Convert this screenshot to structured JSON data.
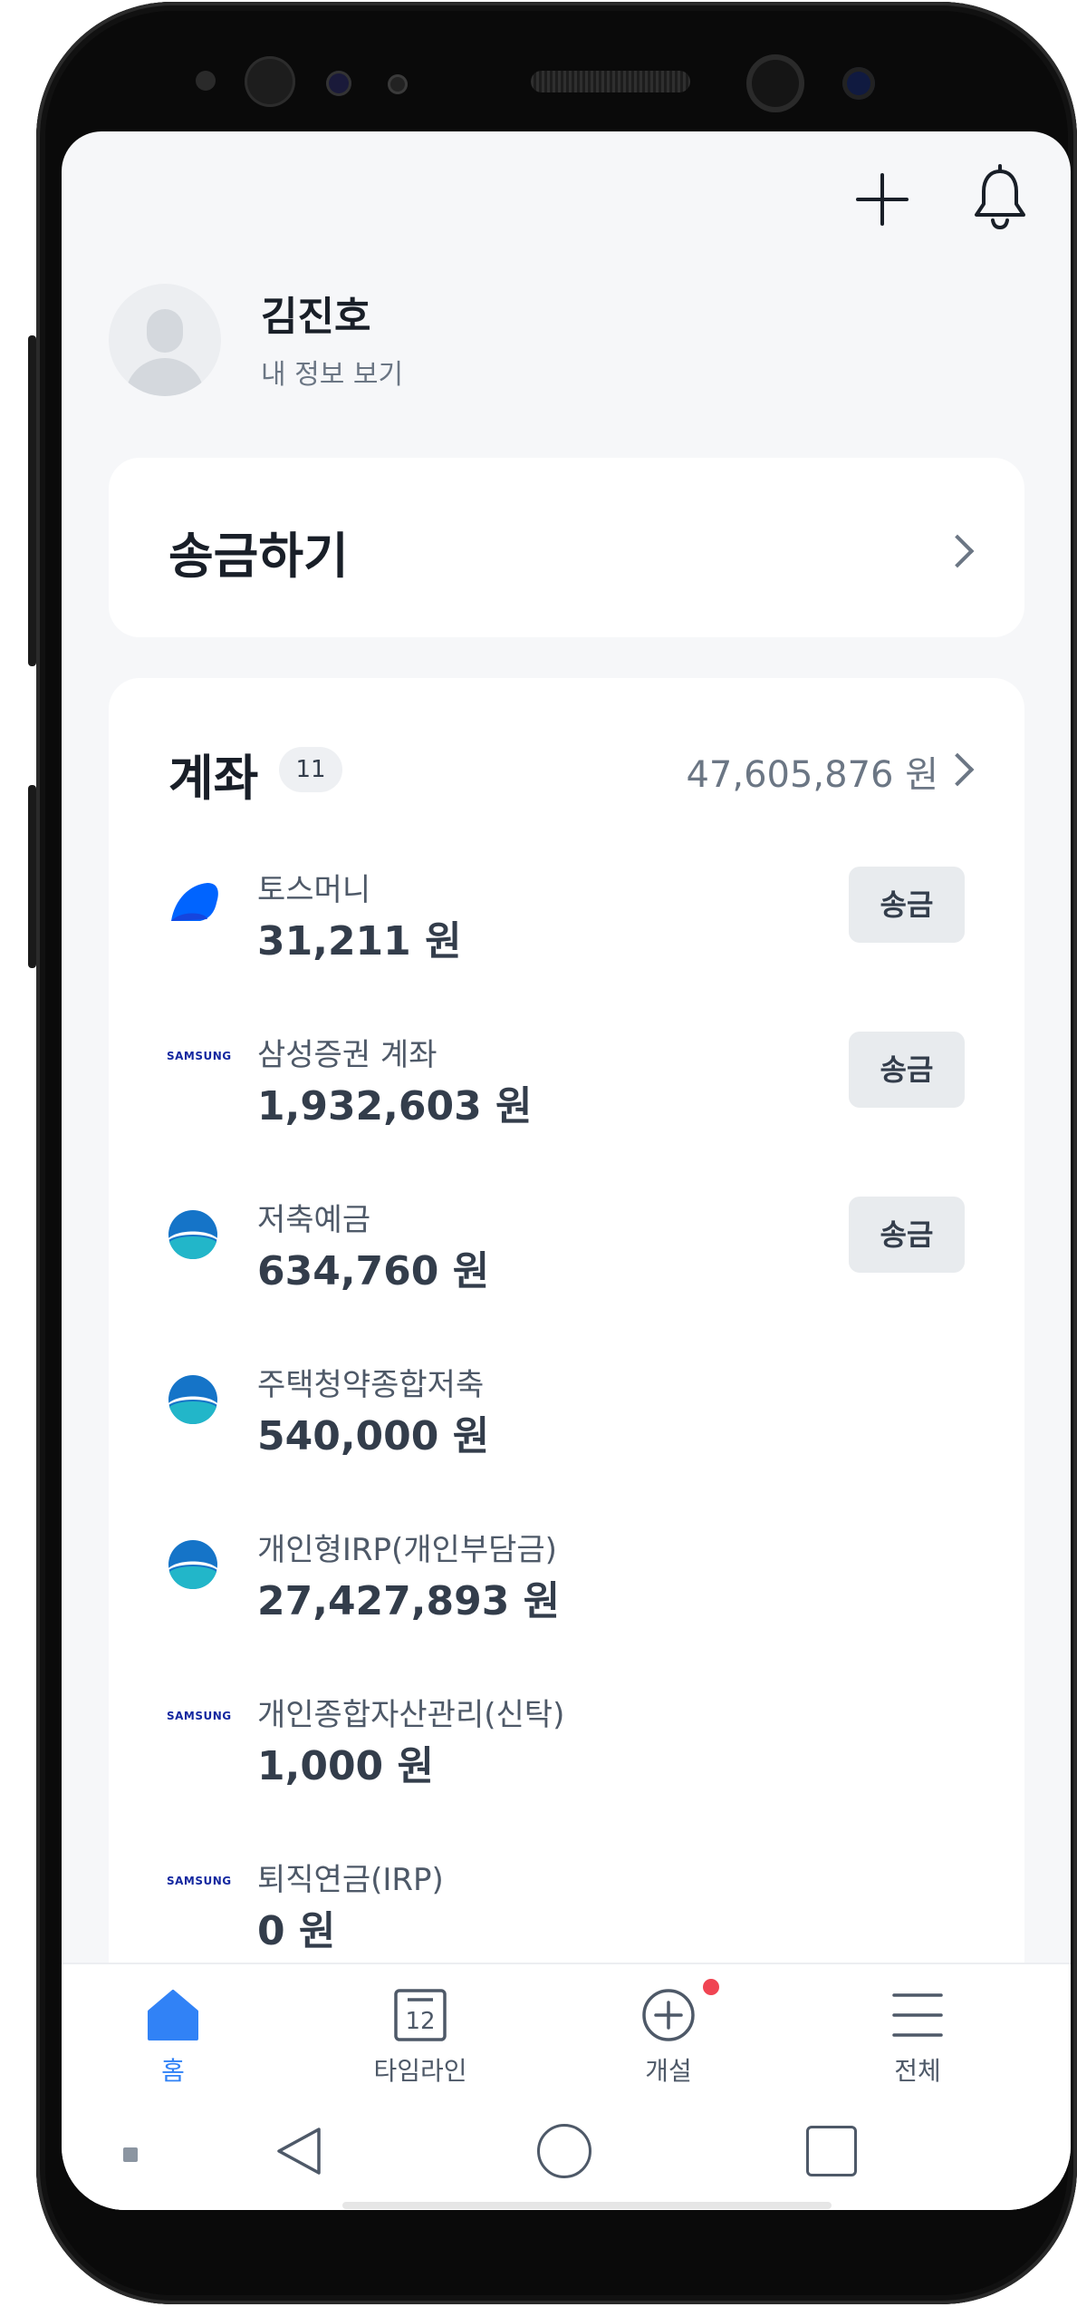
{
  "top_bar": {
    "add_icon": "plus-icon",
    "notification_icon": "bell-icon"
  },
  "profile": {
    "name": "김진호",
    "subtitle": "내 정보 보기"
  },
  "transfer_card": {
    "title": "송금하기"
  },
  "accounts": {
    "title": "계좌",
    "count": "11",
    "total": "47,605,876 원",
    "items": [
      {
        "name": "토스머니",
        "balance": "31,211 원",
        "action": "송금",
        "logo": "toss-logo"
      },
      {
        "name": "삼성증권 계좌",
        "balance": "1,932,603 원",
        "action": "송금",
        "logo": "samsung-logo",
        "logo_text": "SAMSUNG"
      },
      {
        "name": "저축예금",
        "balance": "634,760 원",
        "action": "송금",
        "logo": "bank-logo"
      },
      {
        "name": "주택청약종합저축",
        "balance": "540,000 원",
        "logo": "bank-logo"
      },
      {
        "name": "개인형IRP(개인부담금)",
        "balance": "27,427,893 원",
        "logo": "bank-logo"
      },
      {
        "name": "개인종합자산관리(신탁)",
        "balance": "1,000 원",
        "logo": "samsung-logo",
        "logo_text": "SAMSUNG"
      },
      {
        "name": "퇴직연금(IRP)",
        "balance": "0 원",
        "logo": "samsung-logo",
        "logo_text": "SAMSUNG"
      }
    ]
  },
  "bottom_nav": {
    "items": [
      {
        "label": "홈",
        "icon": "home-icon",
        "active": true
      },
      {
        "label": "타임라인",
        "icon": "calendar-icon",
        "calendar_day": "12"
      },
      {
        "label": "개설",
        "icon": "plus-circle-icon",
        "has_badge": true
      },
      {
        "label": "전체",
        "icon": "menu-icon"
      }
    ]
  },
  "colors": {
    "accent": "#3182f6",
    "text_primary": "#191f28",
    "text_secondary": "#6b7684",
    "badge": "#f04452",
    "screen_bg": "#f6f7f9"
  }
}
